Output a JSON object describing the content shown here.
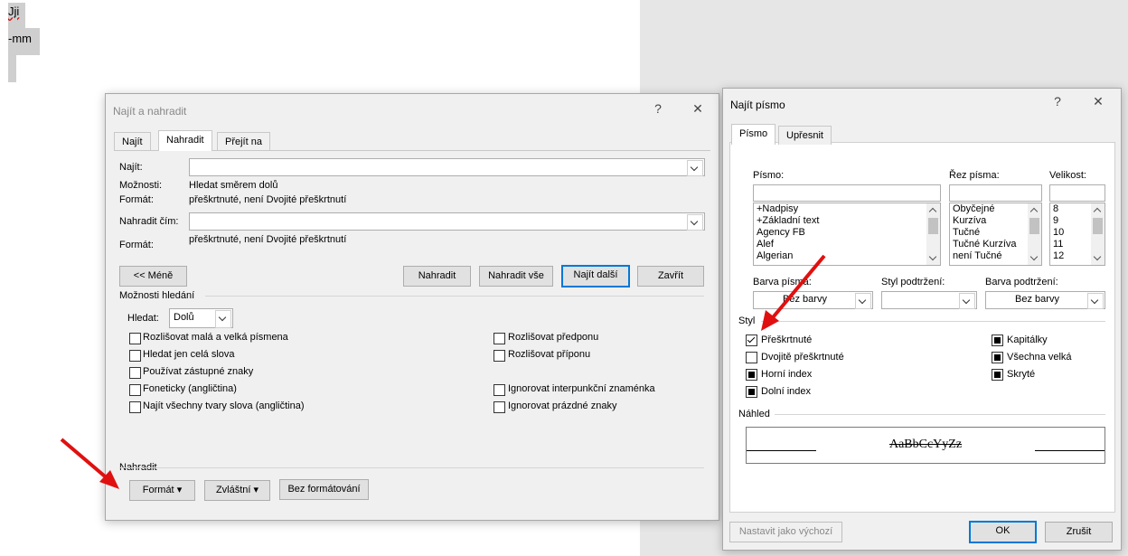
{
  "document": {
    "lines": [
      "Jji",
      "-mm"
    ]
  },
  "find_replace": {
    "title": "Najít a nahradit",
    "tabs": [
      "Najít",
      "Nahradit",
      "Přejít na"
    ],
    "find_label": "Najít:",
    "find_value": "",
    "options_label": "Možnosti:",
    "options_value": "Hledat směrem dolů",
    "format_label": "Formát:",
    "find_format_value": "přeškrtnuté, není Dvojité přeškrtnutí",
    "replace_label": "Nahradit čím:",
    "replace_value": "",
    "replace_format_label": "Formát:",
    "replace_format_value": "přeškrtnuté, není Dvojité přeškrtnutí",
    "buttons": {
      "less": "<< Méně",
      "replace": "Nahradit",
      "replace_all": "Nahradit vše",
      "find_next": "Najít další",
      "close": "Zavřít"
    },
    "search_options_heading": "Možnosti hledání",
    "search_label": "Hledat:",
    "search_value": "Dolů",
    "left_options": [
      "Rozlišovat malá a velká písmena",
      "Hledat jen celá slova",
      "Používat zástupné znaky",
      "Foneticky (angličtina)",
      "Najít všechny tvary slova (angličtina)"
    ],
    "right_options": [
      "Rozlišovat předponu",
      "Rozlišovat příponu",
      "Ignorovat interpunkční znaménka",
      "Ignorovat prázdné znaky"
    ],
    "replace_heading": "Nahradit",
    "bottom_buttons": {
      "format": "Formát",
      "special": "Zvláštní",
      "no_formatting": "Bez formátování"
    }
  },
  "find_font": {
    "title": "Najít písmo",
    "tabs": [
      "Písmo",
      "Upřesnit"
    ],
    "font_label": "Písmo:",
    "font_value": "",
    "fonts": [
      "+Nadpisy",
      "+Základní text",
      "Agency FB",
      "Alef",
      "Algerian"
    ],
    "style_label": "Řez písma:",
    "style_value": "",
    "styles": [
      "Obyčejné",
      "Kurzíva",
      "Tučné",
      "Tučné Kurzíva",
      "není Tučné"
    ],
    "size_label": "Velikost:",
    "size_value": "",
    "sizes": [
      "8",
      "9",
      "10",
      "11",
      "12"
    ],
    "font_color_label": "Barva písma:",
    "font_color_value": "Bez barvy",
    "underline_style_label": "Styl podtržení:",
    "underline_style_value": "",
    "underline_color_label": "Barva podtržení:",
    "underline_color_value": "Bez barvy",
    "effects_heading": "Styl",
    "effects_left": [
      {
        "label": "Přeškrtnuté",
        "state": "checked"
      },
      {
        "label": "Dvojitě přeškrtnuté",
        "state": "unchecked"
      },
      {
        "label": "Horní index",
        "state": "indeterminate"
      },
      {
        "label": "Dolní index",
        "state": "indeterminate"
      }
    ],
    "effects_right": [
      {
        "label": "Kapitálky",
        "state": "indeterminate"
      },
      {
        "label": "Všechna velká",
        "state": "indeterminate"
      },
      {
        "label": "Skryté",
        "state": "indeterminate"
      }
    ],
    "preview_heading": "Náhled",
    "preview_text": "AaBbCcYyZz",
    "buttons": {
      "set_default": "Nastavit jako výchozí",
      "ok": "OK",
      "cancel": "Zrušit"
    }
  },
  "colors": {
    "arrow": "#e01010",
    "accent": "#0078d7"
  }
}
